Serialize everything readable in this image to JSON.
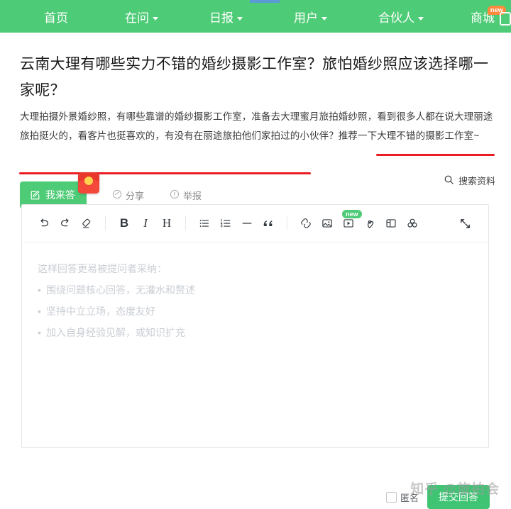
{
  "navbar": {
    "brand_color": "#4ecb76",
    "items": [
      {
        "label": "首页",
        "has_caret": false,
        "badge": ""
      },
      {
        "label": "在问",
        "has_caret": true,
        "badge": ""
      },
      {
        "label": "日报",
        "has_caret": true,
        "badge": ""
      },
      {
        "label": "用户",
        "has_caret": true,
        "badge": ""
      },
      {
        "label": "合伙人",
        "has_caret": true,
        "badge": ""
      },
      {
        "label": "商城",
        "has_caret": false,
        "badge": "new"
      }
    ],
    "right_icon": "app-download-icon"
  },
  "question": {
    "title": "云南大理有哪些实力不错的婚纱摄影工作室？旅怕婚纱照应该选择哪一家呢？",
    "body": "大理拍摄外景婚纱照，有哪些靠谱的婚纱摄影工作室，准备去大理蜜月旅拍婚纱照，看到很多人都在说大理丽途旅拍挺火的，看客片也挺喜欢的，有没有在丽途旅拍他们家拍过的小伙伴？推荐一下大理不错的摄影工作室~",
    "annotation_color": "#ec1c24"
  },
  "actions": {
    "answer_label": "我来答",
    "answer_color": "#4ecb76",
    "redpacket_icon": "red-packet-icon",
    "share_label": "分享",
    "report_label": "举报",
    "search_materials_label": "搜索资料"
  },
  "editor": {
    "toolbar": [
      {
        "name": "undo-icon",
        "glyph": "",
        "badge": ""
      },
      {
        "name": "redo-icon",
        "glyph": "",
        "badge": ""
      },
      {
        "name": "clear-format-icon",
        "glyph": "",
        "badge": ""
      },
      {
        "name": "bold-icon",
        "glyph": "B",
        "badge": ""
      },
      {
        "name": "italic-icon",
        "glyph": "I",
        "badge": ""
      },
      {
        "name": "heading-icon",
        "glyph": "H",
        "badge": ""
      },
      {
        "name": "bullet-list-icon",
        "glyph": "",
        "badge": ""
      },
      {
        "name": "ordered-list-icon",
        "glyph": "",
        "badge": ""
      },
      {
        "name": "horizontal-rule-icon",
        "glyph": "",
        "badge": ""
      },
      {
        "name": "blockquote-icon",
        "glyph": "",
        "badge": ""
      },
      {
        "name": "link-icon",
        "glyph": "",
        "badge": ""
      },
      {
        "name": "image-icon",
        "glyph": "",
        "badge": ""
      },
      {
        "name": "video-icon",
        "glyph": "",
        "badge": "new"
      },
      {
        "name": "location-icon",
        "glyph": "",
        "badge": ""
      },
      {
        "name": "table-icon",
        "glyph": "",
        "badge": ""
      },
      {
        "name": "formula-icon",
        "glyph": "",
        "badge": ""
      },
      {
        "name": "fullscreen-icon",
        "glyph": "",
        "badge": ""
      }
    ],
    "video_badge": "new",
    "placeholder_heading": "这样回答更易被提问者采纳：",
    "placeholder_items": [
      "围绕问题核心回答，无灌水和赘述",
      "坚持中立立场，态度友好",
      "加入自身经验见解，或知识扩充"
    ],
    "value": ""
  },
  "footer": {
    "anonymous_label": "匿名",
    "anonymous_checked": false,
    "submit_label": "提交回答",
    "submit_color": "#3fc474"
  },
  "watermark": {
    "text": "知乎 @旅拍会"
  }
}
